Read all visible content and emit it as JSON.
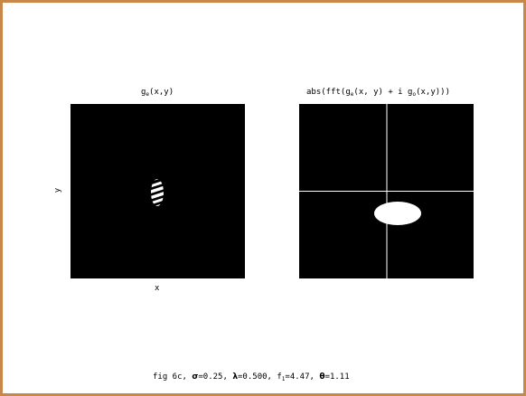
{
  "colors": {
    "frame_border": "#c8884a",
    "background": "#ffffff",
    "panel": "#000000",
    "foreground": "#ffffff"
  },
  "left_panel": {
    "title_prefix": "g",
    "title_sub": "e",
    "title_suffix": "(x,y)",
    "xlabel": "x",
    "ylabel": "y"
  },
  "right_panel": {
    "title_a": "abs(fft(g",
    "title_sub_a": "e",
    "title_b": "(x, y) + i g",
    "title_sub_b": "o",
    "title_c": "(x,y)))"
  },
  "caption": {
    "part1": "fig 6c, ",
    "sigma_symbol": "σ",
    "part2": "=0.25, ",
    "lambda_symbol": "λ",
    "part3": "=0.500,  f",
    "f_sub": "1",
    "part4": "=4.47, ",
    "theta_symbol": "θ",
    "part5": "=1.11"
  }
}
